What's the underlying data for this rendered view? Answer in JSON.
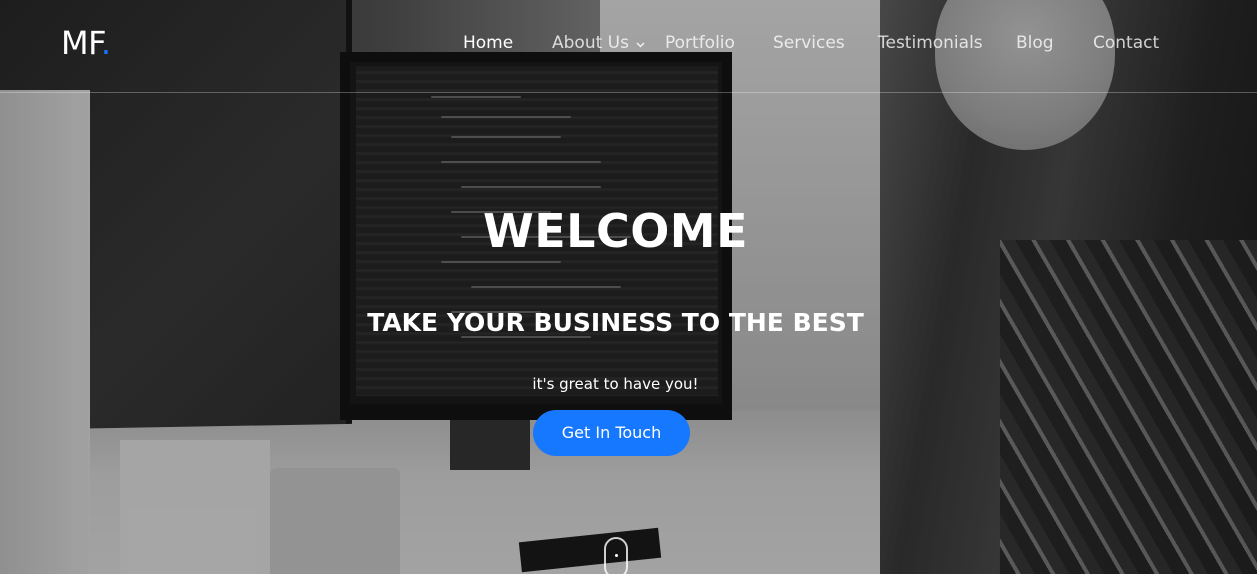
{
  "brand": {
    "logo_text": "MF",
    "logo_dot": ".",
    "accent_color": "#1677ff"
  },
  "nav": {
    "items": [
      {
        "label": "Home",
        "active": true
      },
      {
        "label": "About Us",
        "has_dropdown": true
      },
      {
        "label": "Portfolio"
      },
      {
        "label": "Services"
      },
      {
        "label": "Testimonials"
      },
      {
        "label": "Blog"
      },
      {
        "label": "Contact"
      }
    ],
    "dropdown_icon": "chevron-down-icon"
  },
  "hero": {
    "title": "WELCOME",
    "subtitle": "TAKE YOUR BUSINESS TO THE BEST",
    "tagline": "it's great to have you!",
    "cta_label": "Get In Touch",
    "scroll_icon": "mouse-scroll-icon"
  }
}
